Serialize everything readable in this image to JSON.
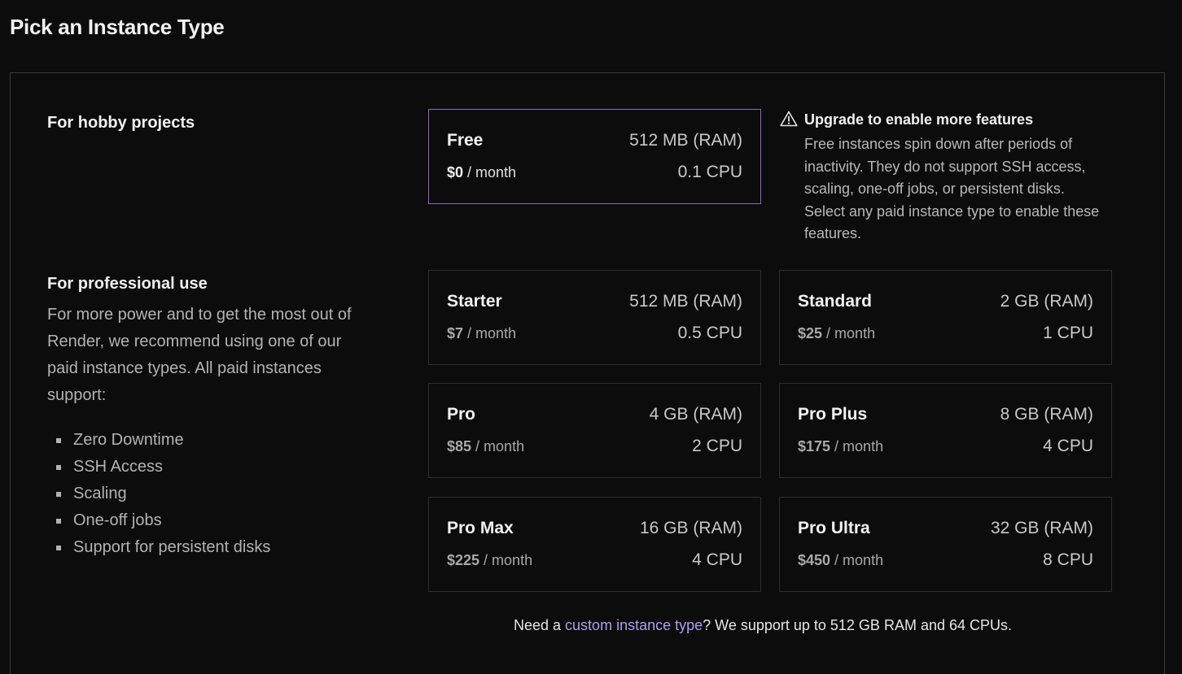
{
  "page": {
    "title": "Pick an Instance Type"
  },
  "hobby": {
    "heading": "For hobby projects"
  },
  "professional": {
    "heading": "For professional use",
    "description": "For more power and to get the most out of Render, we recommend using one of our paid instance types. All paid instances support:",
    "features": [
      "Zero Downtime",
      "SSH Access",
      "Scaling",
      "One-off jobs",
      "Support for persistent disks"
    ]
  },
  "free_card": {
    "name": "Free",
    "ram": "512 MB (RAM)",
    "price": "$0",
    "period": " / month",
    "cpu": "0.1 CPU",
    "selected": true
  },
  "warning": {
    "icon": "warning-triangle-icon",
    "title": "Upgrade to enable more features",
    "body": "Free instances spin down after periods of inactivity. They do not support SSH access, scaling, one-off jobs, or persistent disks. Select any paid instance type to enable these features."
  },
  "paid_cards": [
    {
      "name": "Starter",
      "ram": "512 MB (RAM)",
      "price": "$7",
      "period": " / month",
      "cpu": "0.5 CPU"
    },
    {
      "name": "Standard",
      "ram": "2 GB (RAM)",
      "price": "$25",
      "period": " / month",
      "cpu": "1 CPU"
    },
    {
      "name": "Pro",
      "ram": "4 GB (RAM)",
      "price": "$85",
      "period": " / month",
      "cpu": "2 CPU"
    },
    {
      "name": "Pro Plus",
      "ram": "8 GB (RAM)",
      "price": "$175",
      "period": " / month",
      "cpu": "4 CPU"
    },
    {
      "name": "Pro Max",
      "ram": "16 GB (RAM)",
      "price": "$225",
      "period": " / month",
      "cpu": "4 CPU"
    },
    {
      "name": "Pro Ultra",
      "ram": "32 GB (RAM)",
      "price": "$450",
      "period": " / month",
      "cpu": "8 CPU"
    }
  ],
  "footer": {
    "prefix": "Need a ",
    "link_text": "custom instance type",
    "suffix": "? We support up to 512 GB RAM and 64 CPUs."
  },
  "colors": {
    "background": "#0c0c0c",
    "selected_border": "#8a6bc7",
    "link": "#b59cf0"
  }
}
